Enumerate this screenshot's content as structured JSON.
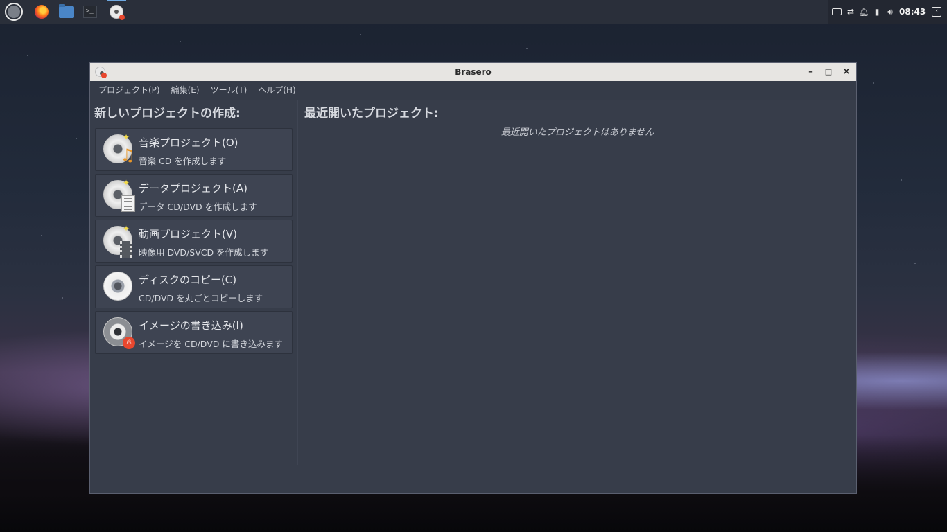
{
  "taskbar": {
    "launchers": [
      "menu-icon",
      "firefox-icon",
      "file-manager-icon",
      "terminal-icon",
      "brasero-icon"
    ],
    "terminal_glyph": ">_",
    "clock": "08:43"
  },
  "window": {
    "title": "Brasero",
    "minimize": "–",
    "maximize": "□",
    "close": "×"
  },
  "menubar": {
    "items": [
      "プロジェクト(P)",
      "編集(E)",
      "ツール(T)",
      "ヘルプ(H)"
    ]
  },
  "left": {
    "heading": "新しいプロジェクトの作成:",
    "projects": [
      {
        "title": "音楽プロジェクト(O)",
        "desc": "音楽 CD を作成します",
        "icon": "audio-disc-icon"
      },
      {
        "title": "データプロジェクト(A)",
        "desc": "データ CD/DVD を作成します",
        "icon": "data-disc-icon"
      },
      {
        "title": "動画プロジェクト(V)",
        "desc": "映像用 DVD/SVCD を作成します",
        "icon": "video-disc-icon"
      },
      {
        "title": "ディスクのコピー(C)",
        "desc": "CD/DVD を丸ごとコピーします",
        "icon": "copy-disc-icon"
      },
      {
        "title": "イメージの書き込み(I)",
        "desc": "イメージを CD/DVD に書き込みます",
        "icon": "burn-image-icon"
      }
    ]
  },
  "right": {
    "heading": "最近開いたプロジェクト:",
    "empty_text": "最近開いたプロジェクトはありません"
  }
}
